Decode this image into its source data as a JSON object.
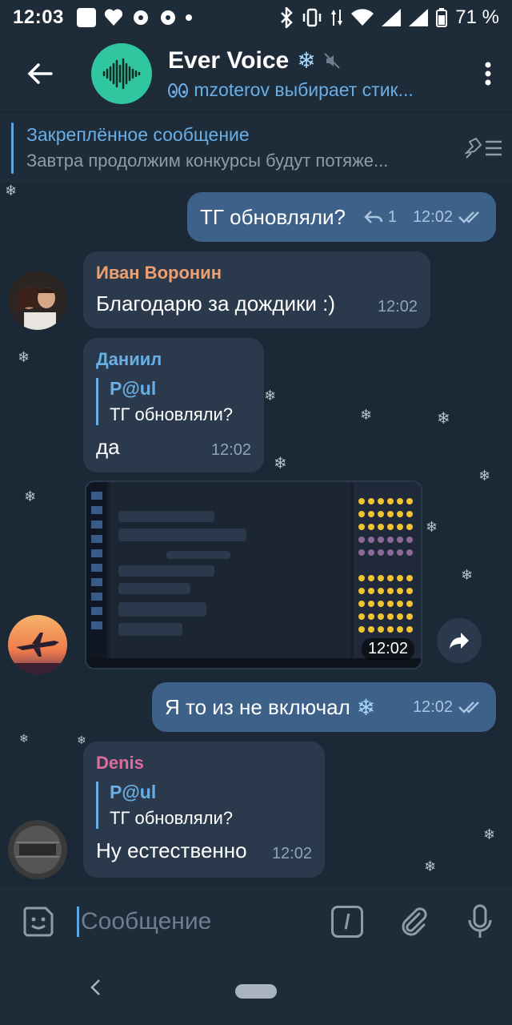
{
  "status_bar": {
    "time": "12:03",
    "battery": "71 %"
  },
  "header": {
    "title": "Ever Voice",
    "status": "mzoterov выбирает стик..."
  },
  "pinned": {
    "title": "Закреплённое сообщение",
    "text": "Завтра продолжим  конкурсы будут потяже..."
  },
  "messages": [
    {
      "type": "out",
      "text": "ТГ обновляли?",
      "replies": "1",
      "time": "12:02"
    },
    {
      "type": "in",
      "sender": "Иван Воронин",
      "sender_color": "#f0a070",
      "text": "Благодарю за дождики :)",
      "time": "12:02"
    },
    {
      "type": "in",
      "sender": "Даниил",
      "sender_color": "#6aaee6",
      "reply_name": "P@ul",
      "reply_text": "ТГ обновляли?",
      "text": "да",
      "time": "12:02"
    },
    {
      "type": "photo",
      "time": "12:02"
    },
    {
      "type": "out",
      "text": "Я то из не включал",
      "time": "12:02"
    },
    {
      "type": "in",
      "sender": "Denis",
      "sender_color": "#e06c9f",
      "reply_name": "P@ul",
      "reply_text": "ТГ обновляли?",
      "text": "Ну естественно",
      "time": "12:02"
    }
  ],
  "input": {
    "placeholder": "Сообщение",
    "slash_label": "/"
  },
  "colors": {
    "background": "#1b2836",
    "bar": "#1e2c3a",
    "outgoing_bubble": "#3e6189",
    "incoming_bubble": "#2a3a4c",
    "accent": "#6aaee6"
  }
}
